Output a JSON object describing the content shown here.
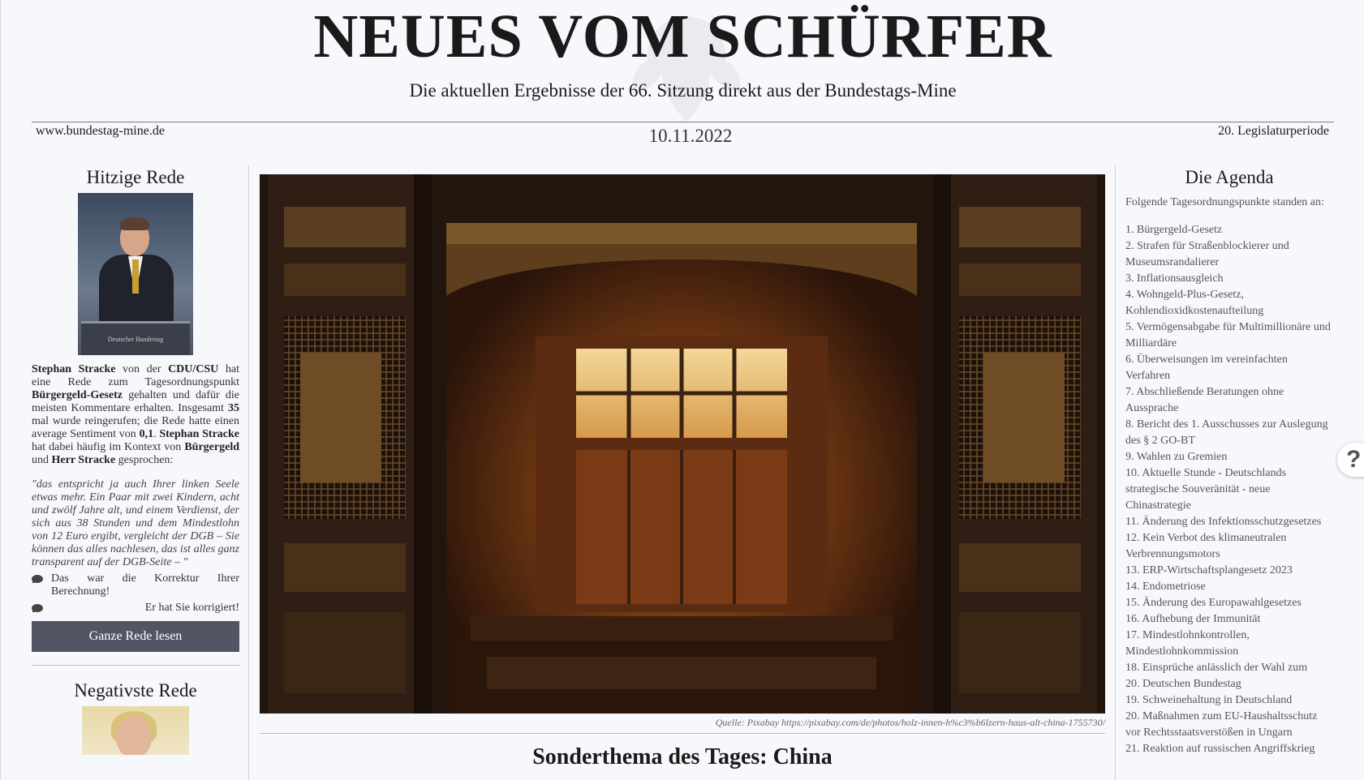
{
  "masthead": {
    "title": "NEUES VOM SCHÜRFER",
    "subtitle": "Die aktuellen Ergebnisse der 66. Sitzung direkt aus der Bundestags-Mine",
    "url": "www.bundestag-mine.de",
    "date": "10.11.2022",
    "legislature": "20. Legislaturperiode"
  },
  "left": {
    "heading": "Hitzige Rede",
    "photo_label": "Deutscher Bundestag",
    "summary": {
      "speaker": "Stephan Stracke",
      "t1": " von der ",
      "party": "CDU/CSU",
      "t2": " hat eine Rede zum Tagesordnungspunkt ",
      "topic": "Bürgergeld-Gesetz",
      "t3": " gehalten und dafür die meisten Kommentare erhalten. Insgesamt ",
      "count": "35",
      "t4": " mal wurde reingerufen; die Rede hatte einen average Sentiment von ",
      "sentiment": "0,1",
      "t5": ". ",
      "speaker2": "Stephan Stracke",
      "t6": " hat dabei häufig im Kontext von ",
      "kw1": "Bürgergeld",
      "t7": " und ",
      "kw2": "Herr Stracke",
      "t8": " gesprochen:"
    },
    "quote": "\"das entspricht ja auch Ihrer linken Seele etwas mehr. Ein Paar mit zwei Kindern, acht und zwölf Jahre alt, und einem Verdienst, der sich aus 38 Stunden und dem Mindestlohn von 12 Euro ergibt, vergleicht der DGB – Sie können das alles nachlesen, das ist alles ganz transparent auf der DGB-Seite – \"",
    "comments": [
      "Das war die Korrektur Ihrer Berechnung!",
      "Er hat Sie korrigiert!"
    ],
    "read_button": "Ganze Rede lesen",
    "neg_heading": "Negativste Rede"
  },
  "center": {
    "image_caption": "Quelle: Pixabay https://pixabay.com/de/photos/holz-innen-h%c3%b6lzern-haus-alt-china-1755730/",
    "special_heading": "Sonderthema des Tages: China"
  },
  "right": {
    "heading": "Die Agenda",
    "intro": "Folgende Tagesordnungspunkte standen an:",
    "agenda": [
      "1. Bürgergeld-Gesetz",
      "2. Strafen für Straßenblockierer und Museumsrandalierer",
      "3. Inflationsausgleich",
      "4. Wohngeld-Plus-Gesetz, Kohlendioxidkostenaufteilung",
      "5. Vermögensabgabe für Multimillionäre und Milliardäre",
      "6. Überweisungen im vereinfachten Verfahren",
      "7. Abschließende Beratungen ohne Aussprache",
      "8. Bericht des 1. Ausschusses zur Auslegung des § 2 GO-BT",
      "9. Wahlen zu Gremien",
      "10. Aktuelle Stunde - Deutschlands strategische Souveränität - neue Chinastrategie",
      "11. Änderung des Infektionsschutzgesetzes",
      "12. Kein Verbot des klimaneutralen Verbrennungsmotors",
      "13. ERP-Wirtschaftsplangesetz 2023",
      "14. Endometriose",
      "15. Änderung des Europawahlgesetzes",
      "16. Aufhebung der Immunität",
      "17. Mindestlohnkontrollen, Mindestlohnkommission",
      "18. Einsprüche anlässlich der Wahl zum",
      "20. Deutschen Bundestag",
      "19. Schweinehaltung in Deutschland",
      "20. Maßnahmen zum EU-Haushaltsschutz vor Rechtsstaatsverstößen in Ungarn",
      "21. Reaktion auf russischen Angriffskrieg"
    ]
  },
  "help": {
    "label": "?"
  },
  "colors": {
    "background": "#f7f8fc",
    "button": "#535565",
    "text": "#1a1a1a",
    "muted": "#555555"
  }
}
